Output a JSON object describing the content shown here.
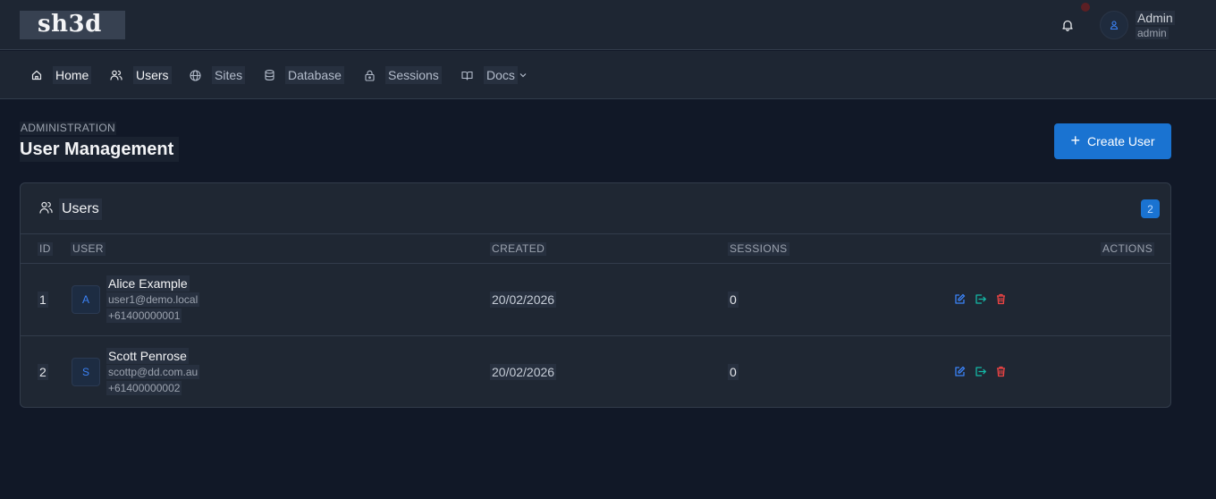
{
  "header": {
    "logo_text": "sh3d",
    "user_name": "Admin",
    "user_role": "admin"
  },
  "nav": {
    "items": [
      {
        "label": "Home",
        "icon": "home-icon"
      },
      {
        "label": "Users",
        "icon": "users-icon"
      },
      {
        "label": "Sites",
        "icon": "globe-icon"
      },
      {
        "label": "Database",
        "icon": "database-icon"
      },
      {
        "label": "Sessions",
        "icon": "lock-icon"
      },
      {
        "label": "Docs",
        "icon": "book-icon"
      }
    ]
  },
  "page": {
    "section": "ADMINISTRATION",
    "title": "User Management",
    "create_label": "Create User"
  },
  "table": {
    "title": "Users",
    "count": "2",
    "columns": {
      "id": "ID",
      "user": "USER",
      "created": "CREATED",
      "sessions": "SESSIONS",
      "actions": "ACTIONS"
    },
    "rows": [
      {
        "id": "1",
        "initial": "A",
        "name": "Alice Example",
        "email": "user1@demo.local",
        "phone": "+61400000001",
        "created": "20/02/2026",
        "sessions": "0"
      },
      {
        "id": "2",
        "initial": "S",
        "name": "Scott Penrose",
        "email": "scottp@dd.com.au",
        "phone": "+61400000002",
        "created": "20/02/2026",
        "sessions": "0"
      }
    ]
  },
  "colors": {
    "accent": "#1a73d1",
    "edit": "#3b82f6",
    "login": "#14b8a6",
    "delete": "#ef4444",
    "background": "#111827",
    "surface": "#1f2733"
  }
}
